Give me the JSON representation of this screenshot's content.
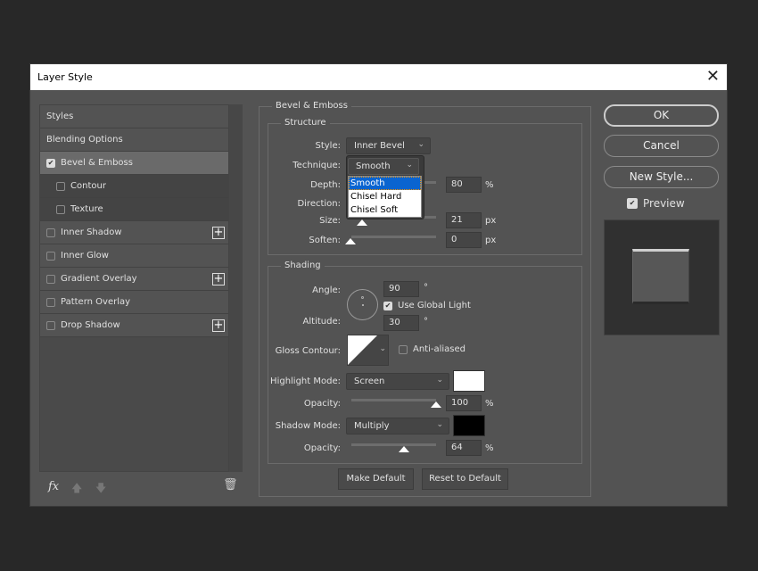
{
  "window": {
    "title": "Layer Style",
    "close_icon": "close-icon"
  },
  "sidebar": {
    "items": [
      {
        "label": "Styles",
        "checkbox": null,
        "selected": false,
        "sub": false,
        "plus": false
      },
      {
        "label": "Blending Options",
        "checkbox": null,
        "selected": false,
        "sub": false,
        "plus": false
      },
      {
        "label": "Bevel & Emboss",
        "checkbox": true,
        "selected": true,
        "sub": false,
        "plus": false
      },
      {
        "label": "Contour",
        "checkbox": false,
        "selected": false,
        "sub": true,
        "plus": false
      },
      {
        "label": "Texture",
        "checkbox": false,
        "selected": false,
        "sub": true,
        "plus": false
      },
      {
        "label": "Inner Shadow",
        "checkbox": false,
        "selected": false,
        "sub": false,
        "plus": true
      },
      {
        "label": "Inner Glow",
        "checkbox": false,
        "selected": false,
        "sub": false,
        "plus": false
      },
      {
        "label": "Gradient Overlay",
        "checkbox": false,
        "selected": false,
        "sub": false,
        "plus": true
      },
      {
        "label": "Pattern Overlay",
        "checkbox": false,
        "selected": false,
        "sub": false,
        "plus": false
      },
      {
        "label": "Drop Shadow",
        "checkbox": false,
        "selected": false,
        "sub": false,
        "plus": true
      }
    ],
    "footer": {
      "fx": "fx"
    }
  },
  "bevel": {
    "title": "Bevel & Emboss",
    "structure": {
      "title": "Structure",
      "style_label": "Style:",
      "style_value": "Inner Bevel",
      "technique_label": "Technique:",
      "technique_value": "Smooth",
      "technique_options": [
        "Smooth",
        "Chisel Hard",
        "Chisel Soft"
      ],
      "depth_label": "Depth:",
      "depth": "80",
      "depth_unit": "%",
      "direction_label": "Direction:",
      "size_label": "Size:",
      "size": "21",
      "size_unit": "px",
      "soften_label": "Soften:",
      "soften": "0",
      "soften_unit": "px"
    },
    "shading": {
      "title": "Shading",
      "angle_label": "Angle:",
      "angle": "90",
      "deg": "°",
      "global_light": "Use Global Light",
      "altitude_label": "Altitude:",
      "altitude": "30",
      "gloss_label": "Gloss Contour:",
      "anti_aliased": "Anti-aliased",
      "highlight_label": "Highlight Mode:",
      "highlight_mode": "Screen",
      "highlight_color": "#ffffff",
      "hl_opacity_label": "Opacity:",
      "hl_opacity": "100",
      "pct": "%",
      "shadow_label": "Shadow Mode:",
      "shadow_mode": "Multiply",
      "shadow_color": "#000000",
      "sh_opacity_label": "Opacity:",
      "sh_opacity": "64"
    },
    "make_default": "Make Default",
    "reset_default": "Reset to Default"
  },
  "right": {
    "ok": "OK",
    "cancel": "Cancel",
    "new_style": "New Style...",
    "preview": "Preview"
  }
}
